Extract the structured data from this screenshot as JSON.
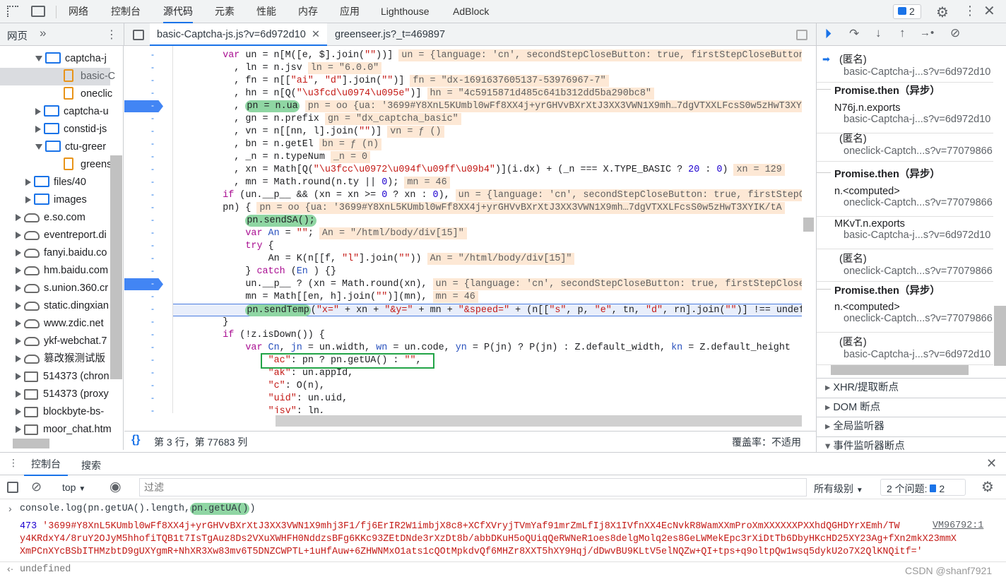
{
  "top_tabs": [
    "网络",
    "控制台",
    "源代码",
    "元素",
    "性能",
    "内存",
    "应用",
    "Lighthouse",
    "AdBlock"
  ],
  "active_top_tab": "源代码",
  "issues_badge": "2",
  "nav": {
    "tab": "网页",
    "more": "»",
    "items": [
      {
        "label": "captcha-j",
        "type": "folder",
        "open": true,
        "level": 2
      },
      {
        "label": "basic-C",
        "type": "file",
        "level": 3,
        "selected": true
      },
      {
        "label": "oneclic",
        "type": "file",
        "level": 3
      },
      {
        "label": "captcha-u",
        "type": "folder",
        "level": 2
      },
      {
        "label": "constid-js",
        "type": "folder",
        "level": 2
      },
      {
        "label": "ctu-greer",
        "type": "folder",
        "open": true,
        "level": 2
      },
      {
        "label": "greens",
        "type": "file",
        "level": 3
      },
      {
        "label": "files/40",
        "type": "folder",
        "level": 1
      },
      {
        "label": "images",
        "type": "folder",
        "level": 1
      },
      {
        "label": "e.so.com",
        "type": "cloud",
        "level": 0
      },
      {
        "label": "eventreport.di",
        "type": "cloud",
        "level": 0
      },
      {
        "label": "fanyi.baidu.co",
        "type": "cloud",
        "level": 0
      },
      {
        "label": "hm.baidu.com",
        "type": "cloud",
        "level": 0
      },
      {
        "label": "s.union.360.cr",
        "type": "cloud",
        "level": 0
      },
      {
        "label": "static.dingxian",
        "type": "cloud",
        "level": 0
      },
      {
        "label": "www.zdic.net",
        "type": "cloud",
        "level": 0
      },
      {
        "label": "ykf-webchat.7",
        "type": "cloud",
        "level": 0
      },
      {
        "label": "篡改猴测试版",
        "type": "cloud",
        "level": 0
      },
      {
        "label": "514373 (chron",
        "type": "frame",
        "level": 0
      },
      {
        "label": "514373 (proxy",
        "type": "frame",
        "level": 0
      },
      {
        "label": "blockbyte-bs-",
        "type": "frame",
        "level": 0
      },
      {
        "label": "moor_chat.htm",
        "type": "frame",
        "level": 0
      }
    ]
  },
  "editor_tabs": [
    {
      "label": "basic-Captcha-js.js?v=6d972d10",
      "active": true
    },
    {
      "label": "greenseer.js?_t=469897",
      "active": false
    }
  ],
  "code": [
    {
      "i": 4,
      "t": [
        [
          "k",
          "var "
        ],
        [
          "",
          "un = n[M([e, $].join("
        ],
        [
          "s",
          "\"\""
        ],
        [
          "",
          "))]"
        ]
      ],
      "a": "un = {language: 'cn', secondStepCloseButton: true, firstStepCloseButton"
    },
    {
      "i": 6,
      "t": [
        [
          "",
          ", ln = n.jsv"
        ]
      ],
      "a": "ln = \"6.0.0\""
    },
    {
      "i": 6,
      "t": [
        [
          "",
          ", fn = n[["
        ],
        [
          "s",
          "\"ai\""
        ],
        [
          "",
          ", "
        ],
        [
          "s",
          "\"d\""
        ],
        [
          "",
          "].join("
        ],
        [
          "s",
          "\"\""
        ],
        [
          "",
          ")]"
        ]
      ],
      "a": "fn = \"dx-1691637605137-53976967-7\""
    },
    {
      "i": 6,
      "t": [
        [
          "",
          ", hn = n[Q("
        ],
        [
          "s",
          "\"\\u3fcd\\u0974\\u095e\""
        ],
        [
          "",
          ")]"
        ]
      ],
      "a": "hn = \"4c5915871d485c641b312dd5ba290bc8\""
    },
    {
      "i": 6,
      "t": [
        [
          "",
          ", "
        ],
        [
          "hl",
          "pn = n.ua"
        ]
      ],
      "a": "pn = oo {ua: '3699#Y8XnL5KUmbl0wFf8XX4j+yrGHVvBXrXtJ3XX3VWN1X9mh…7dgVTXXLFcsS0w5zHwT3XYIK"
    },
    {
      "i": 6,
      "t": [
        [
          "",
          ", gn = n.prefix"
        ]
      ],
      "a": "gn = \"dx_captcha_basic\""
    },
    {
      "i": 6,
      "t": [
        [
          "",
          ", vn = n[[nn, l].join("
        ],
        [
          "s",
          "\"\""
        ],
        [
          "",
          ")]"
        ]
      ],
      "a": "vn = ƒ ()"
    },
    {
      "i": 6,
      "t": [
        [
          "",
          ", bn = n.getEl"
        ]
      ],
      "a": "bn = ƒ (n)"
    },
    {
      "i": 6,
      "t": [
        [
          "",
          ", _n = n.typeNum"
        ]
      ],
      "a": "_n = 0"
    },
    {
      "i": 6,
      "t": [
        [
          "",
          ", xn = Math[Q("
        ],
        [
          "s",
          "\"\\u3fcc\\u0972\\u094f\\u09ff\\u09b4\""
        ],
        [
          "",
          ")](i.dx) + (_n === X.TYPE_BASIC ? "
        ],
        [
          "n",
          "20"
        ],
        [
          "",
          " : "
        ],
        [
          "n",
          "0"
        ],
        [
          "",
          ")"
        ]
      ],
      "a": "xn = 129"
    },
    {
      "i": 6,
      "t": [
        [
          "",
          ", mn = Math.round(n.ty || "
        ],
        [
          "n",
          "0"
        ],
        [
          "",
          ");"
        ]
      ],
      "a": "mn = 46"
    },
    {
      "i": 4,
      "t": [
        [
          "k",
          "if "
        ],
        [
          "",
          "(un.__p__ && (xn = xn >= "
        ],
        [
          "n",
          "0"
        ],
        [
          "",
          " ? xn : "
        ],
        [
          "n",
          "0"
        ],
        [
          "",
          "),"
        ]
      ],
      "a": "un = {language: 'cn', secondStepCloseButton: true, firstStepCloseButton"
    },
    {
      "i": 4,
      "t": [
        [
          "",
          "pn) {"
        ]
      ],
      "a": "pn = oo {ua: '3699#Y8XnL5KUmbl0wFf8XX4j+yrGHVvBXrXtJ3XX3VWN1X9mh…7dgVTXXLFcsS0w5zHwT3XYIK/tA"
    },
    {
      "i": 8,
      "t": [
        [
          "hl",
          "pn.sendSA();"
        ]
      ],
      "a": ""
    },
    {
      "i": 8,
      "t": [
        [
          "k",
          "var "
        ],
        [
          "v",
          "An"
        ],
        [
          "",
          " = "
        ],
        [
          "s",
          "\"\""
        ],
        [
          "",
          ";"
        ]
      ],
      "a": "An = \"/html/body/div[15]\""
    },
    {
      "i": 8,
      "t": [
        [
          "k",
          "try"
        ],
        [
          "",
          " {"
        ]
      ],
      "a": ""
    },
    {
      "i": 12,
      "t": [
        [
          "",
          "An = K(n[[f, "
        ],
        [
          "s",
          "\"l\""
        ],
        [
          "",
          "].join("
        ],
        [
          "s",
          "\"\""
        ],
        [
          "",
          "))"
        ]
      ],
      "a": "An = \"/html/body/div[15]\""
    },
    {
      "i": 8,
      "t": [
        [
          "",
          "} "
        ],
        [
          "k",
          "catch"
        ],
        [
          "",
          " ("
        ],
        [
          "v",
          "En"
        ],
        [
          "",
          " ) {}"
        ]
      ],
      "a": ""
    },
    {
      "i": 8,
      "t": [
        [
          "",
          "un.__p__ ? (xn = Math.round(xn),"
        ]
      ],
      "a": "un = {language: 'cn', secondStepCloseButton: true, firstStepCloseButton"
    },
    {
      "i": 8,
      "t": [
        [
          "",
          "mn = Math[[en, h].join("
        ],
        [
          "s",
          "\"\""
        ],
        [
          "",
          ")](mn),"
        ]
      ],
      "a": "mn = 46"
    },
    {
      "i": 8,
      "t": [
        [
          "hl",
          "pn.sendTemp"
        ],
        [
          "",
          "("
        ],
        [
          "s",
          "\"x=\""
        ],
        [
          "",
          " + xn + "
        ],
        [
          "s",
          "\"&y=\""
        ],
        [
          "",
          " + mn + "
        ],
        [
          "s",
          "\"&speed=\""
        ],
        [
          "",
          " + (n[["
        ],
        [
          "s",
          "\"s\""
        ],
        [
          "",
          ", p, "
        ],
        [
          "s",
          "\"e\""
        ],
        [
          "",
          ", tn, "
        ],
        [
          "s",
          "\"d\""
        ],
        [
          "",
          ", rn].join("
        ],
        [
          "s",
          "\"\""
        ],
        [
          "",
          ")] !== undefined"
        ]
      ],
      "a": "",
      "exec": true
    },
    {
      "i": 4,
      "t": [
        [
          "",
          "}"
        ]
      ],
      "a": ""
    },
    {
      "i": 4,
      "t": [
        [
          "k",
          "if "
        ],
        [
          "",
          "(!z.isDown()) {"
        ]
      ],
      "a": ""
    },
    {
      "i": 8,
      "t": [
        [
          "k",
          "var "
        ],
        [
          "v",
          "Cn"
        ],
        [
          "",
          ", "
        ],
        [
          "v",
          "jn"
        ],
        [
          "",
          " = un.width, "
        ],
        [
          "v",
          "wn"
        ],
        [
          "",
          " = un.code, "
        ],
        [
          "v",
          "yn"
        ],
        [
          "",
          " = P(jn) ? P(jn) : Z.default_width, "
        ],
        [
          "v",
          "kn"
        ],
        [
          "",
          " = Z.default_height"
        ]
      ],
      "a": ""
    },
    {
      "i": 12,
      "t": [
        [
          "s",
          "\"ac\""
        ],
        [
          "",
          ": pn ? pn.getUA() : "
        ],
        [
          "s",
          "\"\""
        ],
        [
          "",
          ","
        ]
      ],
      "a": ""
    },
    {
      "i": 12,
      "t": [
        [
          "s",
          "\"ak\""
        ],
        [
          "",
          ": un.appId,"
        ]
      ],
      "a": ""
    },
    {
      "i": 12,
      "t": [
        [
          "s",
          "\"c\""
        ],
        [
          "",
          ": O(n),"
        ]
      ],
      "a": ""
    },
    {
      "i": 12,
      "t": [
        [
          "s",
          "\"uid\""
        ],
        [
          "",
          ": un.uid,"
        ]
      ],
      "a": ""
    },
    {
      "i": 12,
      "t": [
        [
          "s",
          "\"jsv\""
        ],
        [
          "",
          ": ln,"
        ]
      ],
      "a": ""
    }
  ],
  "status": {
    "position": "第 3 行，第 77683 列",
    "coverage": "覆盖率：不适用"
  },
  "callstack": [
    {
      "fn": "(匿名)",
      "loc": "basic-Captcha-j...s?v=6d972d10",
      "current": true
    },
    {
      "async": "Promise.then（异步）"
    },
    {
      "fn": "N76j.n.exports",
      "loc": "basic-Captcha-j...s?v=6d972d10"
    },
    {
      "fn": "(匿名)",
      "loc": "oneclick-Captch...s?v=77079866"
    },
    {
      "async": "Promise.then（异步）"
    },
    {
      "fn": "n.<computed>",
      "loc": "oneclick-Captch...s?v=77079866"
    },
    {
      "fn": "MKvT.n.exports",
      "loc": "basic-Captcha-j...s?v=6d972d10"
    },
    {
      "fn": "(匿名)",
      "loc": "oneclick-Captch...s?v=77079866"
    },
    {
      "async": "Promise.then（异步）"
    },
    {
      "fn": "n.<computed>",
      "loc": "oneclick-Captch...s?v=77079866"
    },
    {
      "fn": "(匿名)",
      "loc": "basic-Captcha-j...s?v=6d972d10"
    }
  ],
  "sections": [
    "XHR/提取断点",
    "DOM 断点",
    "全局监听器",
    "事件监听器断点"
  ],
  "drawer": {
    "tabs": [
      "控制台",
      "搜索"
    ],
    "active": "控制台"
  },
  "console_toolbar": {
    "context": "top",
    "filter_placeholder": "过滤",
    "levels": "所有级别",
    "issues": "2 个问题:",
    "issues_count": "2"
  },
  "console": {
    "input_pre": "console.log(pn.getUA().length,",
    "input_hl": "pn.getUA()",
    "input_post": ")",
    "out_len": "473",
    "out_lines": [
      "'3699#Y8XnL5KUmbl0wFf8XX4j+yrGHVvBXrXtJ3XX3VWN1X9mhj3F1/fj6ErIR2W1imbjX8c8+XCfXVryjTVmYaf91mrZmLfIj8X1IVfnXX4EcNvkR8WamXXmProXmXXXXXXPXXhdQGHDYrXEmh/TW",
      "y4KRdxY4/8ruY2OJyM5hhofiTQB1t7IsTgAuz8Ds2VXuXWHFH0NddzsBFg6KKc93ZEtDNde3rXzDt8b/abbDKuH5oQUiqQeRWNeR1oes8delgMolq2es8GeLWMekEpc3rXiDtTb6DbyHKcHD25XY23Ag+fXn2mkX23mmX",
      "XmPCnXYcBSbITHMzbtD9gUXYgmR+NhXR3Xw83mv6T5DNZCWPTL+1uHfAuw+6ZHWNMxO1ats1cQOtMpkdvQf6MHZr8XXT5hXY9Hqj/dDwvBU9KLtV5elNQZw+QI+tps+q9oltpQw1wsq5dykU2o7X2QlKNQitf='"
    ],
    "source_link": "VM96792:1",
    "result": "undefined"
  },
  "watermark": "CSDN @shanf7921"
}
